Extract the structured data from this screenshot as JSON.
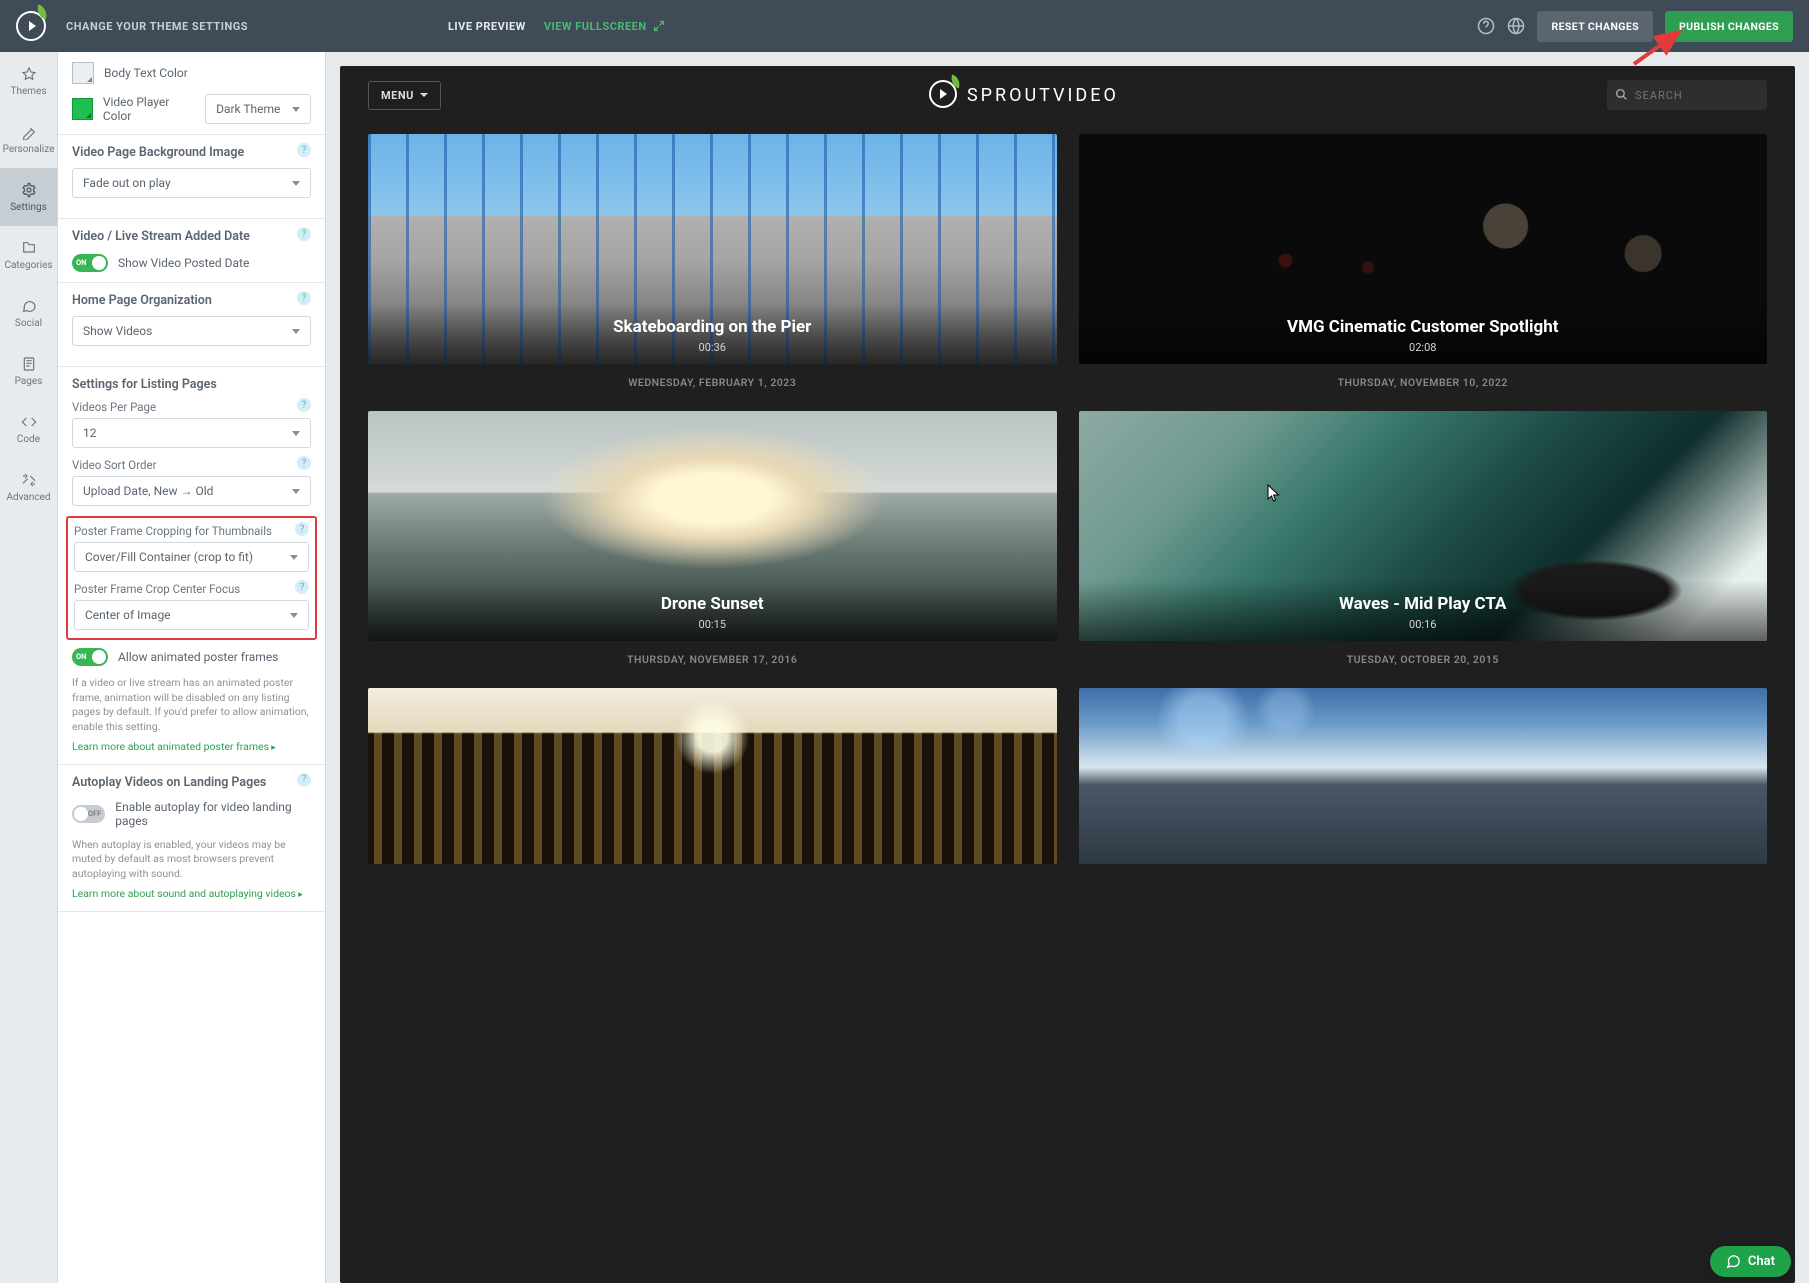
{
  "topbar": {
    "title": "CHANGE YOUR THEME SETTINGS",
    "live_preview": "LIVE PREVIEW",
    "view_fullscreen": "VIEW FULLSCREEN",
    "reset": "RESET CHANGES",
    "publish": "PUBLISH CHANGES"
  },
  "rail": {
    "themes": "Themes",
    "personalize": "Personalize",
    "settings": "Settings",
    "categories": "Categories",
    "social": "Social",
    "pages": "Pages",
    "code": "Code",
    "advanced": "Advanced"
  },
  "panel": {
    "body_text_color": "Body Text Color",
    "video_player_color": "Video Player Color",
    "video_player_theme": "Dark Theme",
    "video_page_bg_title": "Video Page Background Image",
    "video_page_bg_value": "Fade out on play",
    "added_date_title": "Video / Live Stream Added Date",
    "show_posted_date": "Show Video Posted Date",
    "home_org_title": "Home Page Organization",
    "home_org_value": "Show Videos",
    "listing_title": "Settings for Listing Pages",
    "videos_per_page_label": "Videos Per Page",
    "videos_per_page_value": "12",
    "sort_order_label": "Video Sort Order",
    "sort_order_value": "Upload Date, New → Old",
    "crop_label": "Poster Frame Cropping for Thumbnails",
    "crop_value": "Cover/Fill Container (crop to fit)",
    "crop_focus_label": "Poster Frame Crop Center Focus",
    "crop_focus_value": "Center of Image",
    "allow_animated": "Allow animated poster frames",
    "animated_help": "If a video or live stream has an animated poster frame, animation will be disabled on any listing pages by default. If you'd prefer to allow animation, enable this setting.",
    "animated_link": "Learn more about animated poster frames",
    "autoplay_title": "Autoplay Videos on Landing Pages",
    "autoplay_label": "Enable autoplay for video landing pages",
    "autoplay_help": "When autoplay is enabled, your videos may be muted by default as most browsers prevent autoplaying with sound.",
    "autoplay_link": "Learn more about sound and autoplaying videos",
    "on": "ON",
    "off": "OFF"
  },
  "preview": {
    "menu": "MENU",
    "brand": "SPROUTVIDEO",
    "search_placeholder": "SEARCH",
    "cards": [
      {
        "title": "Skateboarding on the Pier",
        "duration": "00:36",
        "date": "Wednesday, February 1, 2023"
      },
      {
        "title": "VMG Cinematic Customer Spotlight",
        "duration": "02:08",
        "date": "Thursday, November 10, 2022"
      },
      {
        "title": "Drone Sunset",
        "duration": "00:15",
        "date": "Thursday, November 17, 2016"
      },
      {
        "title": "Waves - Mid Play CTA",
        "duration": "00:16",
        "date": "Tuesday, October 20, 2015"
      }
    ]
  },
  "chat": "Chat"
}
